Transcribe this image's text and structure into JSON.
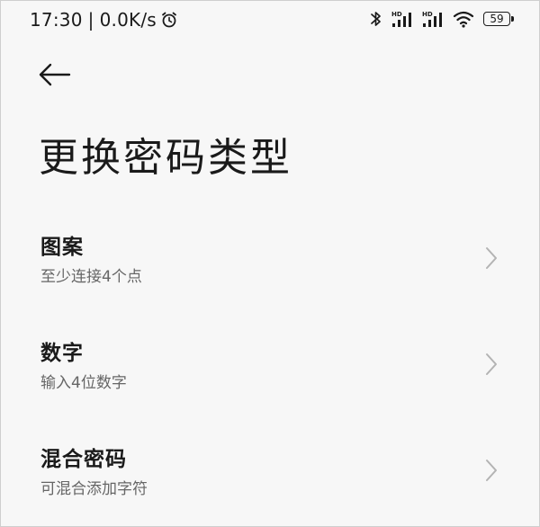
{
  "status_bar": {
    "time": "17:30",
    "separator": "|",
    "net_speed": "0.0K/s",
    "battery_level": "59",
    "icons": [
      "alarm-icon",
      "bluetooth-icon",
      "hd-signal-icon",
      "hd-signal-icon",
      "wifi-icon",
      "battery-icon"
    ]
  },
  "header": {
    "back_icon": "arrow-left-icon"
  },
  "page": {
    "title": "更换密码类型"
  },
  "options": [
    {
      "title": "图案",
      "subtitle": "至少连接4个点"
    },
    {
      "title": "数字",
      "subtitle": "输入4位数字"
    },
    {
      "title": "混合密码",
      "subtitle": "可混合添加字符"
    }
  ],
  "colors": {
    "background": "#f7f7f7",
    "text_primary": "#1a1a1a",
    "text_secondary": "#666666",
    "chevron": "#b3b3b3"
  }
}
